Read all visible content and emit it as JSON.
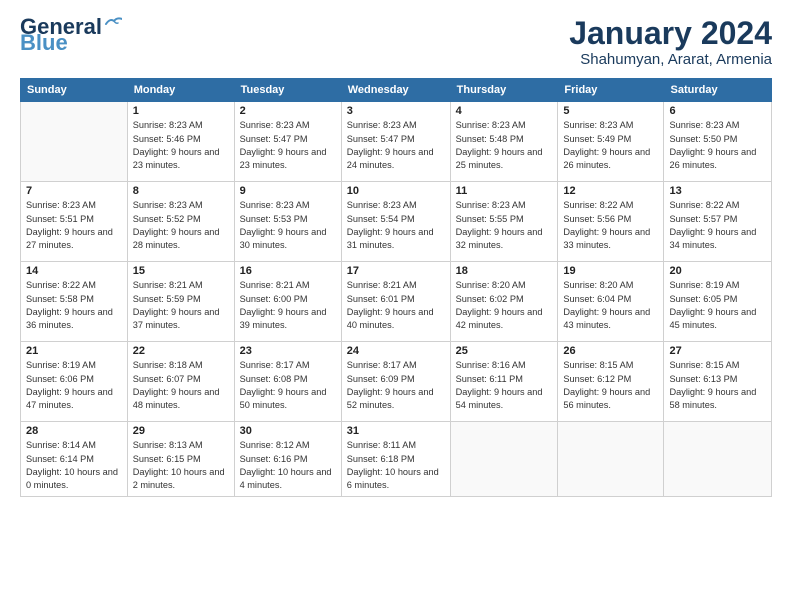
{
  "logo": {
    "line1": "General",
    "line2": "Blue"
  },
  "title": "January 2024",
  "subtitle": "Shahumyan, Ararat, Armenia",
  "header": {
    "days": [
      "Sunday",
      "Monday",
      "Tuesday",
      "Wednesday",
      "Thursday",
      "Friday",
      "Saturday"
    ]
  },
  "weeks": [
    [
      {
        "day": "",
        "sunrise": "",
        "sunset": "",
        "daylight": ""
      },
      {
        "day": "1",
        "sunrise": "Sunrise: 8:23 AM",
        "sunset": "Sunset: 5:46 PM",
        "daylight": "Daylight: 9 hours and 23 minutes."
      },
      {
        "day": "2",
        "sunrise": "Sunrise: 8:23 AM",
        "sunset": "Sunset: 5:47 PM",
        "daylight": "Daylight: 9 hours and 23 minutes."
      },
      {
        "day": "3",
        "sunrise": "Sunrise: 8:23 AM",
        "sunset": "Sunset: 5:47 PM",
        "daylight": "Daylight: 9 hours and 24 minutes."
      },
      {
        "day": "4",
        "sunrise": "Sunrise: 8:23 AM",
        "sunset": "Sunset: 5:48 PM",
        "daylight": "Daylight: 9 hours and 25 minutes."
      },
      {
        "day": "5",
        "sunrise": "Sunrise: 8:23 AM",
        "sunset": "Sunset: 5:49 PM",
        "daylight": "Daylight: 9 hours and 26 minutes."
      },
      {
        "day": "6",
        "sunrise": "Sunrise: 8:23 AM",
        "sunset": "Sunset: 5:50 PM",
        "daylight": "Daylight: 9 hours and 26 minutes."
      }
    ],
    [
      {
        "day": "7",
        "sunrise": "Sunrise: 8:23 AM",
        "sunset": "Sunset: 5:51 PM",
        "daylight": "Daylight: 9 hours and 27 minutes."
      },
      {
        "day": "8",
        "sunrise": "Sunrise: 8:23 AM",
        "sunset": "Sunset: 5:52 PM",
        "daylight": "Daylight: 9 hours and 28 minutes."
      },
      {
        "day": "9",
        "sunrise": "Sunrise: 8:23 AM",
        "sunset": "Sunset: 5:53 PM",
        "daylight": "Daylight: 9 hours and 30 minutes."
      },
      {
        "day": "10",
        "sunrise": "Sunrise: 8:23 AM",
        "sunset": "Sunset: 5:54 PM",
        "daylight": "Daylight: 9 hours and 31 minutes."
      },
      {
        "day": "11",
        "sunrise": "Sunrise: 8:23 AM",
        "sunset": "Sunset: 5:55 PM",
        "daylight": "Daylight: 9 hours and 32 minutes."
      },
      {
        "day": "12",
        "sunrise": "Sunrise: 8:22 AM",
        "sunset": "Sunset: 5:56 PM",
        "daylight": "Daylight: 9 hours and 33 minutes."
      },
      {
        "day": "13",
        "sunrise": "Sunrise: 8:22 AM",
        "sunset": "Sunset: 5:57 PM",
        "daylight": "Daylight: 9 hours and 34 minutes."
      }
    ],
    [
      {
        "day": "14",
        "sunrise": "Sunrise: 8:22 AM",
        "sunset": "Sunset: 5:58 PM",
        "daylight": "Daylight: 9 hours and 36 minutes."
      },
      {
        "day": "15",
        "sunrise": "Sunrise: 8:21 AM",
        "sunset": "Sunset: 5:59 PM",
        "daylight": "Daylight: 9 hours and 37 minutes."
      },
      {
        "day": "16",
        "sunrise": "Sunrise: 8:21 AM",
        "sunset": "Sunset: 6:00 PM",
        "daylight": "Daylight: 9 hours and 39 minutes."
      },
      {
        "day": "17",
        "sunrise": "Sunrise: 8:21 AM",
        "sunset": "Sunset: 6:01 PM",
        "daylight": "Daylight: 9 hours and 40 minutes."
      },
      {
        "day": "18",
        "sunrise": "Sunrise: 8:20 AM",
        "sunset": "Sunset: 6:02 PM",
        "daylight": "Daylight: 9 hours and 42 minutes."
      },
      {
        "day": "19",
        "sunrise": "Sunrise: 8:20 AM",
        "sunset": "Sunset: 6:04 PM",
        "daylight": "Daylight: 9 hours and 43 minutes."
      },
      {
        "day": "20",
        "sunrise": "Sunrise: 8:19 AM",
        "sunset": "Sunset: 6:05 PM",
        "daylight": "Daylight: 9 hours and 45 minutes."
      }
    ],
    [
      {
        "day": "21",
        "sunrise": "Sunrise: 8:19 AM",
        "sunset": "Sunset: 6:06 PM",
        "daylight": "Daylight: 9 hours and 47 minutes."
      },
      {
        "day": "22",
        "sunrise": "Sunrise: 8:18 AM",
        "sunset": "Sunset: 6:07 PM",
        "daylight": "Daylight: 9 hours and 48 minutes."
      },
      {
        "day": "23",
        "sunrise": "Sunrise: 8:17 AM",
        "sunset": "Sunset: 6:08 PM",
        "daylight": "Daylight: 9 hours and 50 minutes."
      },
      {
        "day": "24",
        "sunrise": "Sunrise: 8:17 AM",
        "sunset": "Sunset: 6:09 PM",
        "daylight": "Daylight: 9 hours and 52 minutes."
      },
      {
        "day": "25",
        "sunrise": "Sunrise: 8:16 AM",
        "sunset": "Sunset: 6:11 PM",
        "daylight": "Daylight: 9 hours and 54 minutes."
      },
      {
        "day": "26",
        "sunrise": "Sunrise: 8:15 AM",
        "sunset": "Sunset: 6:12 PM",
        "daylight": "Daylight: 9 hours and 56 minutes."
      },
      {
        "day": "27",
        "sunrise": "Sunrise: 8:15 AM",
        "sunset": "Sunset: 6:13 PM",
        "daylight": "Daylight: 9 hours and 58 minutes."
      }
    ],
    [
      {
        "day": "28",
        "sunrise": "Sunrise: 8:14 AM",
        "sunset": "Sunset: 6:14 PM",
        "daylight": "Daylight: 10 hours and 0 minutes."
      },
      {
        "day": "29",
        "sunrise": "Sunrise: 8:13 AM",
        "sunset": "Sunset: 6:15 PM",
        "daylight": "Daylight: 10 hours and 2 minutes."
      },
      {
        "day": "30",
        "sunrise": "Sunrise: 8:12 AM",
        "sunset": "Sunset: 6:16 PM",
        "daylight": "Daylight: 10 hours and 4 minutes."
      },
      {
        "day": "31",
        "sunrise": "Sunrise: 8:11 AM",
        "sunset": "Sunset: 6:18 PM",
        "daylight": "Daylight: 10 hours and 6 minutes."
      },
      {
        "day": "",
        "sunrise": "",
        "sunset": "",
        "daylight": ""
      },
      {
        "day": "",
        "sunrise": "",
        "sunset": "",
        "daylight": ""
      },
      {
        "day": "",
        "sunrise": "",
        "sunset": "",
        "daylight": ""
      }
    ]
  ]
}
